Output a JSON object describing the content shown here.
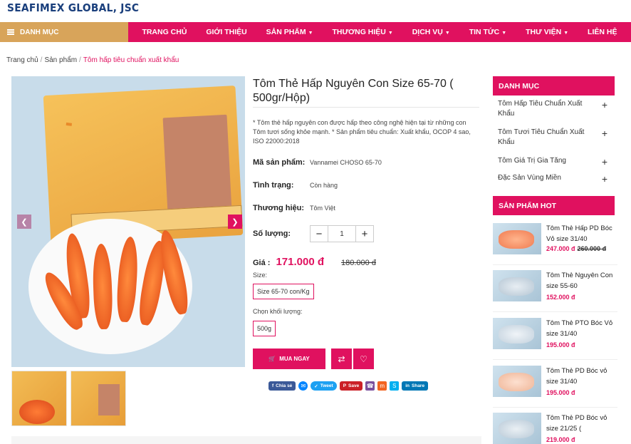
{
  "brand": {
    "logo": "SEAFIMEX GLOBAL, JSC"
  },
  "nav": {
    "category_label": "DANH MỤC",
    "items": [
      {
        "label": "TRANG CHỦ",
        "dropdown": false
      },
      {
        "label": "GIỚI THIỆU",
        "dropdown": false
      },
      {
        "label": "SẢN PHẨM",
        "dropdown": true
      },
      {
        "label": "THƯƠNG HIỆU",
        "dropdown": true
      },
      {
        "label": "DỊCH VỤ",
        "dropdown": true
      },
      {
        "label": "TIN TỨC",
        "dropdown": true
      },
      {
        "label": "THƯ VIỆN",
        "dropdown": true
      },
      {
        "label": "LIÊN HỆ",
        "dropdown": false
      }
    ]
  },
  "breadcrumb": {
    "home": "Trang chủ",
    "section": "Sản phẩm",
    "current": "Tôm hấp tiêu chuẩn xuất khẩu"
  },
  "product": {
    "title": "Tôm Thẻ Hấp Nguyên Con Size 65-70 ( 500gr/Hộp)",
    "description": "* Tôm thẻ hấp nguyên con được hấp theo công nghệ hiện tại từ những con Tôm tươi sống khỏe mạnh. * Sản phẩm tiêu chuẩn: Xuất khẩu, OCOP 4 sao, ISO 22000:2018",
    "sku_label": "Mã sản phẩm:",
    "sku": "Vannamei CHOSO 65-70",
    "status_label": "Tình trạng:",
    "status": "Còn hàng",
    "brand_label": "Thương hiệu:",
    "brand": "Tôm Việt",
    "qty_label": "Số lượng:",
    "qty": "1",
    "price_label": "Giá :",
    "price": "171.000 đ",
    "old_price": "180.000 đ",
    "size_label": "Size:",
    "size_option": "Size 65-70 con/Kg",
    "weight_label": "Chọn khối lượng:",
    "weight_option": "500g",
    "buy_label": "MUA NGAY"
  },
  "share": {
    "facebook": "Chia sẻ",
    "twitter": "Tweet",
    "pinterest": "Save",
    "linkedin": "Share"
  },
  "sidebar": {
    "categories_title": "DANH MỤC",
    "categories": [
      "Tôm Hấp Tiêu Chuẩn Xuất Khẩu",
      "Tôm Tươi Tiêu Chuẩn Xuất Khẩu",
      "Tôm Giá Trị Gia Tăng",
      "Đặc Sản Vùng Miền"
    ],
    "hot_title": "SẢN PHẨM HOT",
    "hot_products": [
      {
        "name": "Tôm Thẻ Hấp PD Bóc Vỏ size 31/40",
        "price": "247.000 đ",
        "old_price": "260.000 đ"
      },
      {
        "name": "Tôm Thẻ Nguyên Con size 55-60",
        "price": "152.000 đ",
        "old_price": ""
      },
      {
        "name": "Tôm Thẻ PTO Bóc Vỏ size 31/40",
        "price": "195.000 đ",
        "old_price": ""
      },
      {
        "name": "Tôm Thẻ PD Bóc vỏ size 31/40",
        "price": "195.000 đ",
        "old_price": ""
      },
      {
        "name": "Tôm Thẻ PD Bóc vỏ size 21/25 (",
        "price": "219.000 đ",
        "old_price": ""
      }
    ]
  },
  "colors": {
    "accent": "#e0115f",
    "category_bar": "#d8a45a",
    "logo": "#1a3f7c"
  }
}
